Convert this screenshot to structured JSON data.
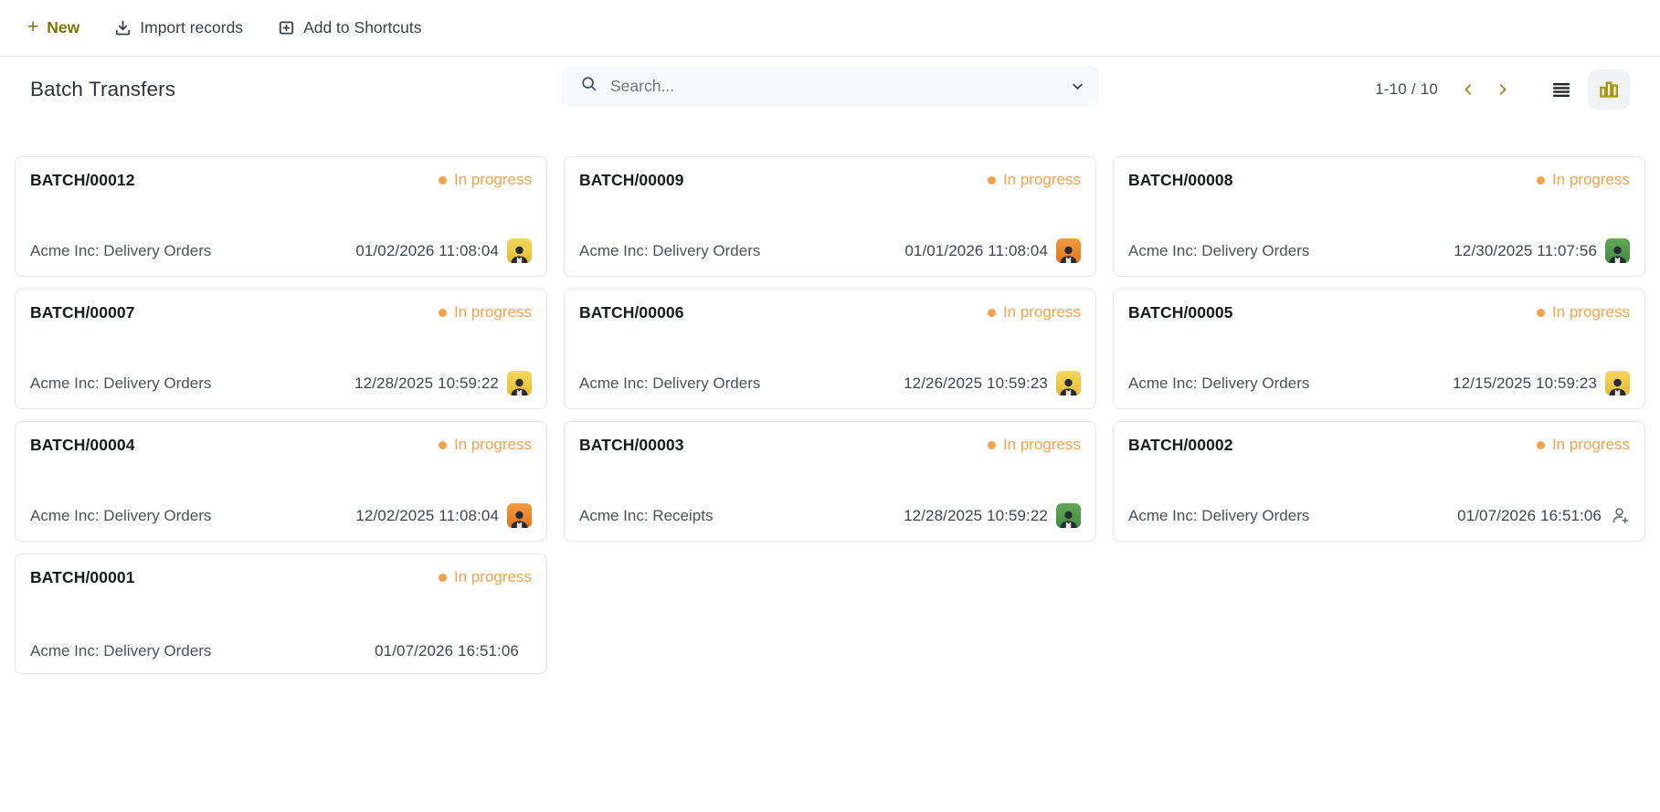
{
  "colors": {
    "accent_olive": "#7c7301",
    "pager_gold": "#a3922e",
    "kanban_icon_gold": "#a89717",
    "status_orange": "#f2a24b",
    "avatar_yellow": "#e8c33a",
    "avatar_orange": "#ed8b2d",
    "avatar_green": "#4f9e4f"
  },
  "toolbar": {
    "new_label": "New",
    "import_label": "Import records",
    "shortcuts_label": "Add to Shortcuts"
  },
  "header": {
    "title": "Batch Transfers",
    "search_placeholder": "Search...",
    "pager_range": "1-10 / 10"
  },
  "view_switcher": {
    "list_view": "list-view",
    "kanban_view": "kanban-view",
    "active": "kanban-view"
  },
  "cards": [
    {
      "name": "BATCH/00012",
      "status": "In progress",
      "operation": "Acme Inc: Delivery Orders",
      "date": "01/02/2026 11:08:04",
      "avatar": "yellow"
    },
    {
      "name": "BATCH/00009",
      "status": "In progress",
      "operation": "Acme Inc: Delivery Orders",
      "date": "01/01/2026 11:08:04",
      "avatar": "orange"
    },
    {
      "name": "BATCH/00008",
      "status": "In progress",
      "operation": "Acme Inc: Delivery Orders",
      "date": "12/30/2025 11:07:56",
      "avatar": "green"
    },
    {
      "name": "BATCH/00007",
      "status": "In progress",
      "operation": "Acme Inc: Delivery Orders",
      "date": "12/28/2025 10:59:22",
      "avatar": "yellow"
    },
    {
      "name": "BATCH/00006",
      "status": "In progress",
      "operation": "Acme Inc: Delivery Orders",
      "date": "12/26/2025 10:59:23",
      "avatar": "yellow"
    },
    {
      "name": "BATCH/00005",
      "status": "In progress",
      "operation": "Acme Inc: Delivery Orders",
      "date": "12/15/2025 10:59:23",
      "avatar": "yellow"
    },
    {
      "name": "BATCH/00004",
      "status": "In progress",
      "operation": "Acme Inc: Delivery Orders",
      "date": "12/02/2025 11:08:04",
      "avatar": "orange"
    },
    {
      "name": "BATCH/00003",
      "status": "In progress",
      "operation": "Acme Inc: Receipts",
      "date": "12/28/2025 10:59:22",
      "avatar": "green"
    },
    {
      "name": "BATCH/00002",
      "status": "In progress",
      "operation": "Acme Inc: Delivery Orders",
      "date": "01/07/2026 16:51:06",
      "avatar": "add-user"
    },
    {
      "name": "BATCH/00001",
      "status": "In progress",
      "operation": "Acme Inc: Delivery Orders",
      "date": "01/07/2026 16:51:06",
      "avatar": "none"
    }
  ]
}
